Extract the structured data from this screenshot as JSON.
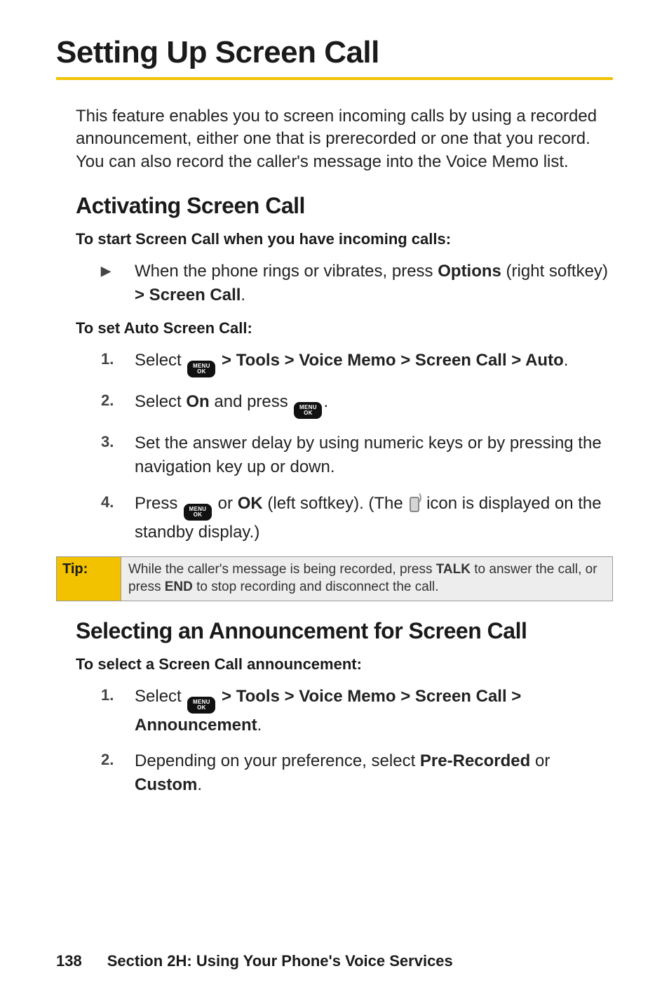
{
  "title": "Setting Up Screen Call",
  "intro": "This feature enables you to screen incoming calls by using a recorded announcement, either one that is prerecorded or one that you record. You can also record the caller's message into the Voice Memo list.",
  "section1": {
    "heading": "Activating Screen Call",
    "lead1": "To start Screen Call when you have incoming calls:",
    "bullet1_pre": "When the phone rings or vibrates, press ",
    "bullet1_bold1": "Options",
    "bullet1_mid": " (right softkey) ",
    "bullet1_bold2": "> Screen Call",
    "bullet1_post": ".",
    "lead2": "To set Auto Screen Call:",
    "steps": {
      "s1": {
        "n": "1.",
        "pre": "Select ",
        "bold": " > Tools > Voice Memo > Screen Call > Auto",
        "post": "."
      },
      "s2": {
        "n": "2.",
        "pre": "Select ",
        "bold": "On",
        "mid": " and press ",
        "post": "."
      },
      "s3": {
        "n": "3.",
        "text": "Set the answer delay by using numeric keys or by pressing the navigation key up or down."
      },
      "s4": {
        "n": "4.",
        "pre": "Press ",
        "mid1": " or ",
        "bold1": "OK",
        "mid2": " (left softkey). (The ",
        "mid3": " icon is displayed on the standby display.)"
      }
    }
  },
  "tip": {
    "label": "Tip:",
    "pre": "While the caller's message is being recorded, press ",
    "bold1": "TALK",
    "mid": " to answer the call, or press ",
    "bold2": "END",
    "post": " to stop recording and disconnect the call."
  },
  "section2": {
    "heading": "Selecting an Announcement for Screen Call",
    "lead": "To select a Screen Call announcement:",
    "steps": {
      "s1": {
        "n": "1.",
        "pre": "Select ",
        "bold": " > Tools > Voice Memo > Screen Call > Announcement",
        "post": "."
      },
      "s2": {
        "n": "2.",
        "pre": "Depending on your preference, select ",
        "bold1": "Pre-Recorded",
        "mid": " or ",
        "bold2": "Custom",
        "post": "."
      }
    }
  },
  "footer": {
    "page": "138",
    "section": "Section 2H: Using Your Phone's Voice Services"
  },
  "icons": {
    "menu_label": "MENU\nOK"
  }
}
